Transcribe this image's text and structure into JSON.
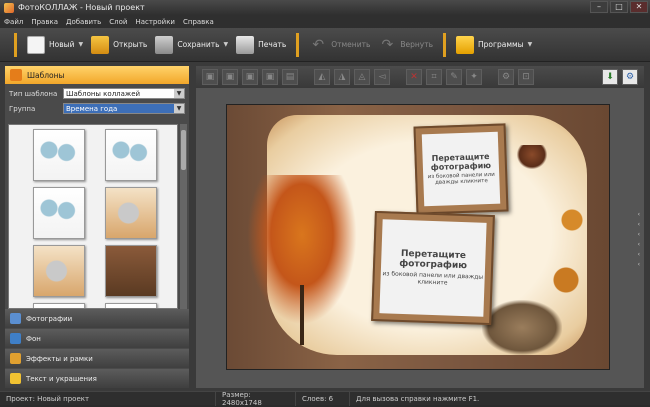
{
  "window": {
    "title": "ФотоКОЛЛАЖ - Новый проект",
    "controls": [
      "–",
      "□",
      "✕"
    ]
  },
  "menu": [
    "Файл",
    "Правка",
    "Добавить",
    "Слой",
    "Настройки",
    "Справка"
  ],
  "toolbar": {
    "new_label": "Новый",
    "open_label": "Открыть",
    "save_label": "Сохранить",
    "print_label": "Печать",
    "undo_label": "Отменить",
    "redo_label": "Вернуть",
    "programs_label": "Программы"
  },
  "left_panel": {
    "templates_header": "Шаблоны",
    "template_type_label": "Тип шаблона",
    "template_type_value": "Шаблоны коллажей",
    "group_label": "Группа",
    "group_value": "Времена года",
    "categories": [
      "Фотографии",
      "Фон",
      "Эффекты и рамки",
      "Текст и украшения"
    ]
  },
  "collage": {
    "frame_big_text": "Перетащите фотографию",
    "frame_small_text": "из боковой панели или дважды кликните"
  },
  "status": {
    "project": "Проект:  Новый проект",
    "size": "Размер:  2480x1748",
    "layers": "Слоев:  6",
    "help": "Для вызова справки нажмите F1."
  }
}
